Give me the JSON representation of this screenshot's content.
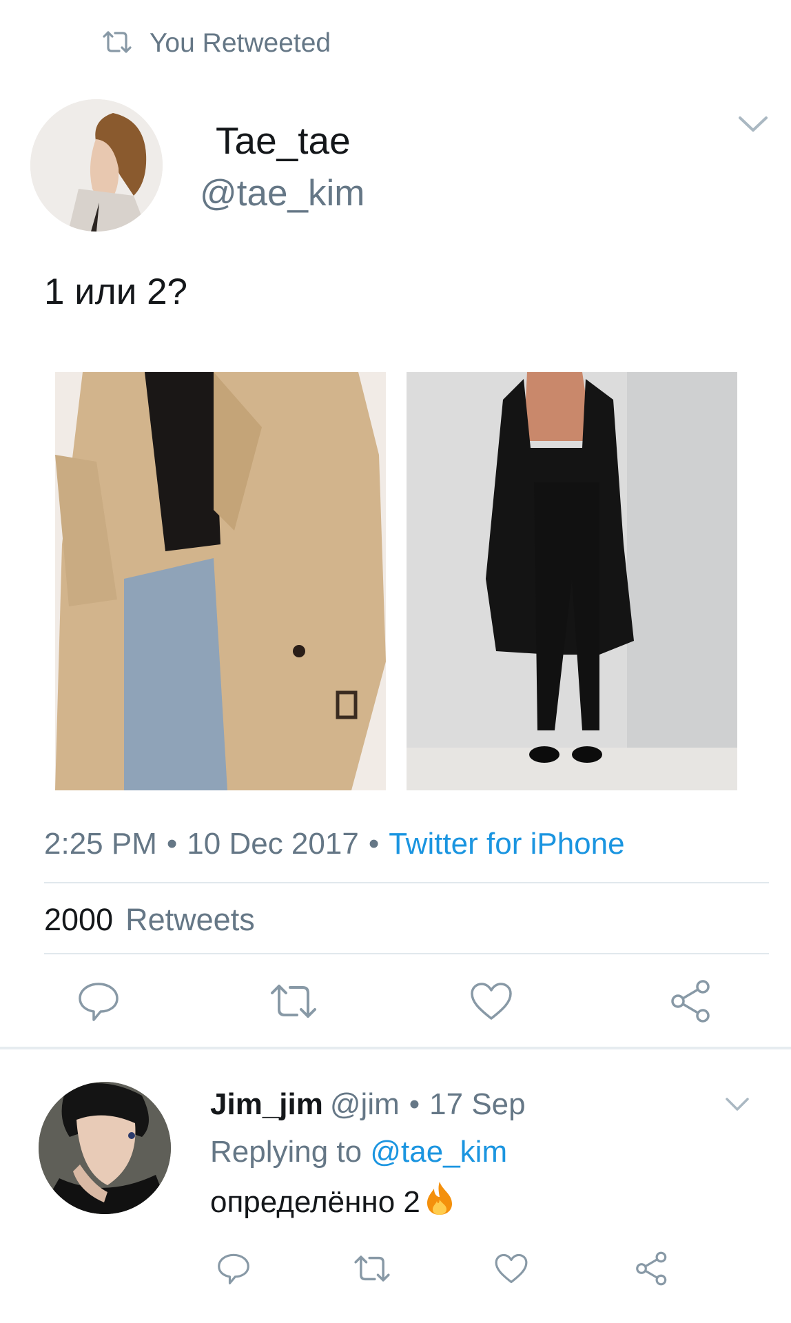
{
  "retweet_header": {
    "label": "You Retweeted"
  },
  "tweet": {
    "display_name": "Tae_tae",
    "handle": "@tae_kim",
    "text": "1 или 2?",
    "time": "2:25 PM",
    "date": "10 Dec 2017",
    "source": "Twitter for iPhone",
    "retweet_count": "2000",
    "retweet_label": "Retweets"
  },
  "reply": {
    "display_name": "Jim_jim",
    "handle": "@jim",
    "date": "17 Sep",
    "replying_label": "Replying to",
    "replying_handle": "@tae_kim",
    "text": "определённо 2"
  },
  "icons": {
    "retweet": "retweet-icon",
    "reply": "reply-icon",
    "like": "heart-icon",
    "share": "share-icon",
    "more": "chevron-down-icon",
    "emoji": "fire-emoji"
  },
  "colors": {
    "link": "#1b95e0",
    "muted": "#657786",
    "text": "#14171a",
    "divider": "#e1e8ed"
  }
}
